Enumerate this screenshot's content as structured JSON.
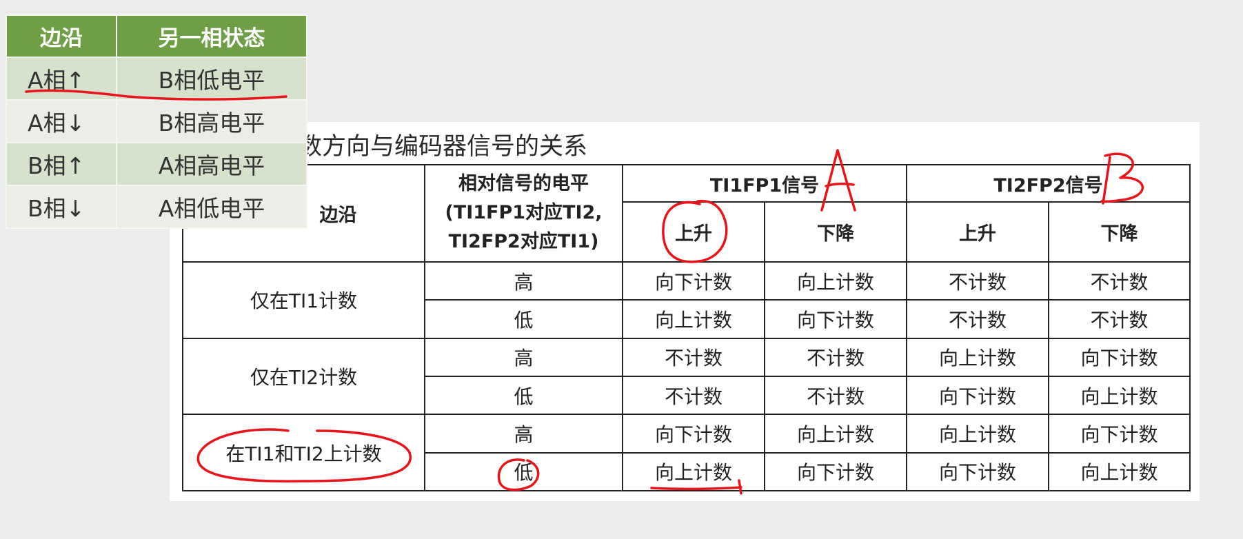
{
  "green_table": {
    "headers": [
      "边沿",
      "另一相状态"
    ],
    "rows": [
      {
        "edge": "A相↑",
        "other": "B相低电平"
      },
      {
        "edge": "A相↓",
        "other": "B相高电平"
      },
      {
        "edge": "B相↑",
        "other": "A相高电平"
      },
      {
        "edge": "B相↓",
        "other": "A相低电平"
      }
    ]
  },
  "caption": "数方向与编码器信号的关系",
  "main_table": {
    "header": {
      "edge": "边沿",
      "relative_level_line1": "相对信号的电平",
      "relative_level_line2": "(TI1FP1对应TI2,",
      "relative_level_line3": "TI2FP2对应TI1)",
      "ti1fp1": "TI1FP1信号",
      "ti2fp2": "TI2FP2信号",
      "rise": "上升",
      "fall": "下降"
    },
    "groups": [
      {
        "edge": "仅在TI1计数",
        "rows": [
          {
            "level": "高",
            "c": [
              "向下计数",
              "向上计数",
              "不计数",
              "不计数"
            ]
          },
          {
            "level": "低",
            "c": [
              "向上计数",
              "向下计数",
              "不计数",
              "不计数"
            ]
          }
        ]
      },
      {
        "edge": "仅在TI2计数",
        "rows": [
          {
            "level": "高",
            "c": [
              "不计数",
              "不计数",
              "向上计数",
              "向下计数"
            ]
          },
          {
            "level": "低",
            "c": [
              "不计数",
              "不计数",
              "向下计数",
              "向上计数"
            ]
          }
        ]
      },
      {
        "edge": "在TI1和TI2上计数",
        "rows": [
          {
            "level": "高",
            "c": [
              "向下计数",
              "向上计数",
              "向上计数",
              "向下计数"
            ]
          },
          {
            "level": "低",
            "c": [
              "向上计数",
              "向下计数",
              "向下计数",
              "向上计数"
            ]
          }
        ]
      }
    ]
  },
  "annotations": {
    "letter_a": "A",
    "letter_b": "B",
    "color": "#e8141a"
  }
}
